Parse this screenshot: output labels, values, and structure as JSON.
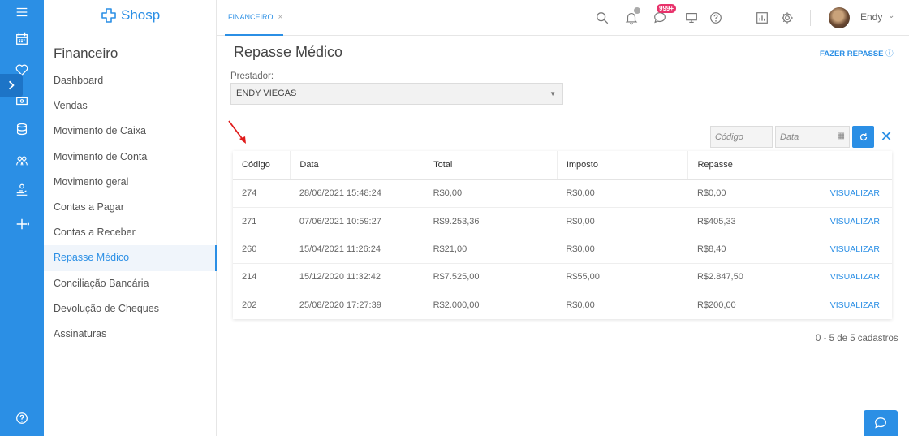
{
  "brand": {
    "name": "Shosp"
  },
  "sidebar": {
    "section_title": "Financeiro",
    "items": [
      {
        "label": "Dashboard",
        "active": false
      },
      {
        "label": "Vendas",
        "active": false
      },
      {
        "label": "Movimento de Caixa",
        "active": false
      },
      {
        "label": "Movimento de Conta",
        "active": false
      },
      {
        "label": "Movimento geral",
        "active": false
      },
      {
        "label": "Contas a Pagar",
        "active": false
      },
      {
        "label": "Contas a Receber",
        "active": false
      },
      {
        "label": "Repasse Médico",
        "active": true
      },
      {
        "label": "Conciliação Bancária",
        "active": false
      },
      {
        "label": "Devolução de Cheques",
        "active": false
      },
      {
        "label": "Assinaturas",
        "active": false
      }
    ]
  },
  "topbar": {
    "tab_label": "FINANCEIRO",
    "tab_close": "×",
    "messages_badge": "999+",
    "user_name": "Endy"
  },
  "page": {
    "title": "Repasse Médico",
    "action_label": "FAZER REPASSE",
    "prestador_label": "Prestador:",
    "prestador_value": "ENDY VIEGAS"
  },
  "filters": {
    "code_placeholder": "Código",
    "date_placeholder": "Data"
  },
  "table": {
    "headers": [
      "Código",
      "Data",
      "Total",
      "Imposto",
      "Repasse",
      ""
    ],
    "rows": [
      {
        "codigo": "274",
        "data": "28/06/2021 15:48:24",
        "total": "R$0,00",
        "imposto": "R$0,00",
        "repasse": "R$0,00",
        "action": "VISUALIZAR"
      },
      {
        "codigo": "271",
        "data": "07/06/2021 10:59:27",
        "total": "R$9.253,36",
        "imposto": "R$0,00",
        "repasse": "R$405,33",
        "action": "VISUALIZAR"
      },
      {
        "codigo": "260",
        "data": "15/04/2021 11:26:24",
        "total": "R$21,00",
        "imposto": "R$0,00",
        "repasse": "R$8,40",
        "action": "VISUALIZAR"
      },
      {
        "codigo": "214",
        "data": "15/12/2020 11:32:42",
        "total": "R$7.525,00",
        "imposto": "R$55,00",
        "repasse": "R$2.847,50",
        "action": "VISUALIZAR"
      },
      {
        "codigo": "202",
        "data": "25/08/2020 17:27:39",
        "total": "R$2.000,00",
        "imposto": "R$0,00",
        "repasse": "R$200,00",
        "action": "VISUALIZAR"
      }
    ]
  },
  "pagination": {
    "summary": "0 - 5 de 5 cadastros"
  },
  "colors": {
    "accent": "#2b8fe5",
    "badge": "#e8326b",
    "annotation_arrow": "#e01b1b"
  }
}
